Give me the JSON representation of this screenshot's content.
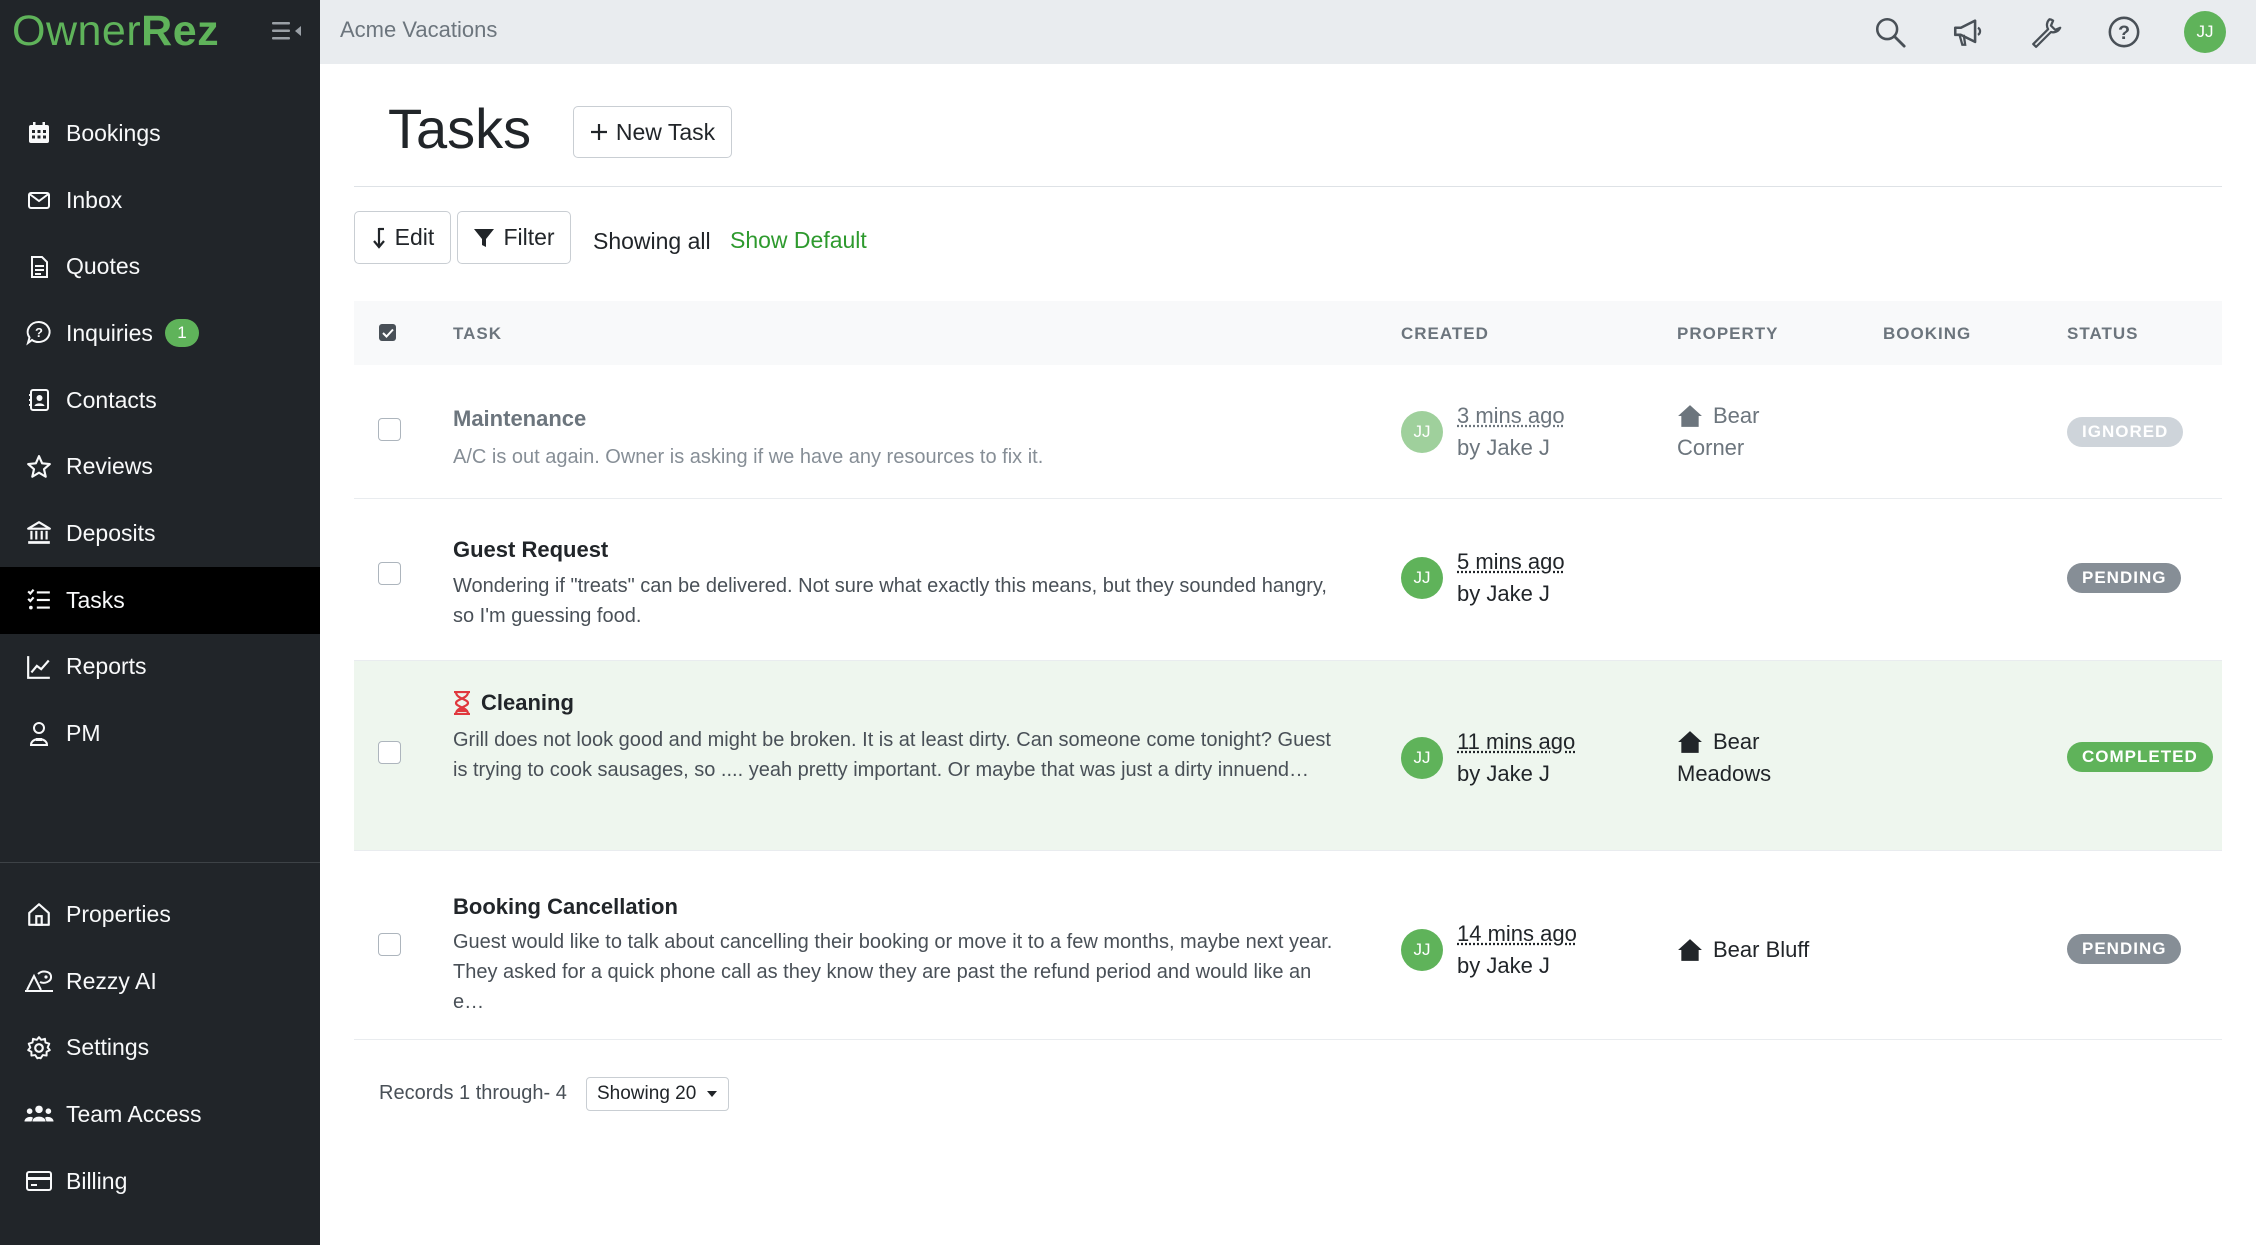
{
  "app": {
    "logo_owner": "Owner",
    "logo_rez": "Rez",
    "account_name": "Acme Vacations",
    "user_initials": "JJ"
  },
  "sidebar": {
    "items": [
      {
        "label": "Bookings",
        "icon": "calendar-icon"
      },
      {
        "label": "Inbox",
        "icon": "envelope-icon"
      },
      {
        "label": "Quotes",
        "icon": "document-icon"
      },
      {
        "label": "Inquiries",
        "icon": "question-bubble-icon",
        "badge": "1"
      },
      {
        "label": "Contacts",
        "icon": "contact-card-icon"
      },
      {
        "label": "Reviews",
        "icon": "star-icon"
      },
      {
        "label": "Deposits",
        "icon": "bank-icon"
      },
      {
        "label": "Tasks",
        "icon": "tasks-list-icon",
        "active": true
      },
      {
        "label": "Reports",
        "icon": "line-chart-icon"
      },
      {
        "label": "PM",
        "icon": "person-icon"
      }
    ],
    "bottom_items": [
      {
        "label": "Properties",
        "icon": "house-outline-icon"
      },
      {
        "label": "Rezzy AI",
        "icon": "ai-assistant-icon"
      },
      {
        "label": "Settings",
        "icon": "gear-icon"
      },
      {
        "label": "Team Access",
        "icon": "team-icon"
      },
      {
        "label": "Billing",
        "icon": "credit-card-icon"
      }
    ]
  },
  "page": {
    "title": "Tasks",
    "new_task_label": "New Task",
    "edit_label": "Edit",
    "filter_label": "Filter",
    "showing_all": "Showing all",
    "show_default": "Show Default"
  },
  "table": {
    "headers": {
      "task": "TASK",
      "created": "CREATED",
      "property": "PROPERTY",
      "booking": "BOOKING",
      "status": "STATUS"
    },
    "rows": [
      {
        "title": "Maintenance",
        "description": "A/C is out again. Owner is asking if we have any resources to fix it.",
        "created_initials": "JJ",
        "created_ago": "3 mins ago",
        "created_by": "by Jake J",
        "property_line1": "Bear",
        "property_line2": "Corner",
        "booking": "",
        "status": "IGNORED",
        "status_color": "#ced4da"
      },
      {
        "title": "Guest Request",
        "description": "Wondering if \"treats\" can be delivered. Not sure what exactly this means, but they sounded hangry, so I'm guessing food.",
        "created_initials": "JJ",
        "created_ago": "5 mins ago",
        "created_by": "by Jake J",
        "property_line1": "",
        "property_line2": "",
        "booking": "",
        "status": "PENDING",
        "status_color": "#868e96"
      },
      {
        "title": "Cleaning",
        "description": "Grill does not look good and might be broken. It is at least dirty. Can someone come tonight? Guest is trying to cook sausages, so .... yeah pretty important. Or maybe that was just a dirty innuend…",
        "created_initials": "JJ",
        "created_ago": "11 mins ago",
        "created_by": "by Jake J",
        "property_line1": "Bear",
        "property_line2": "Meadows",
        "booking": "",
        "status": "COMPLETED",
        "status_color": "#5fb35a",
        "flag_icon": "hourglass-icon"
      },
      {
        "title": "Booking Cancellation",
        "description": "Guest would like to talk about cancelling their booking or move it to a few months, maybe next year. They asked for a quick phone call as they know they are past the refund period and would like an e…",
        "created_initials": "JJ",
        "created_ago": "14 mins ago",
        "created_by": "by Jake J",
        "property_line1": "Bear Bluff",
        "property_line2": "",
        "booking": "",
        "status": "PENDING",
        "status_color": "#868e96"
      }
    ]
  },
  "footer": {
    "records": "Records 1 through- 4",
    "page_size": "Showing 20"
  },
  "colors": {
    "brand_green": "#5fb35a",
    "sidebar_bg": "#212529",
    "link_green": "#2e9a2e",
    "row_highlight": "#eef6ee",
    "hourglass_red": "#e0383e"
  }
}
